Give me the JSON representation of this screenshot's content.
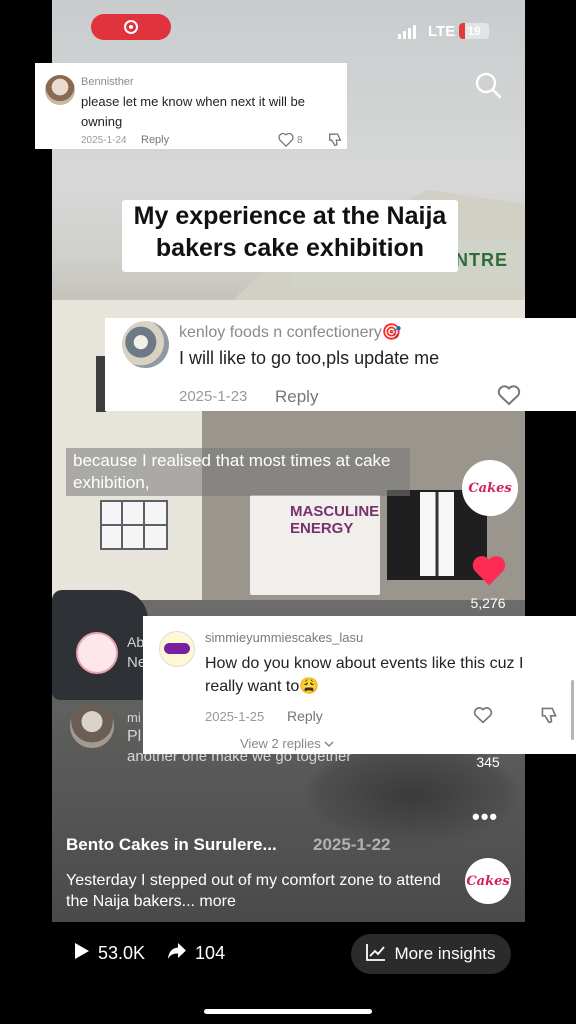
{
  "status_bar": {
    "network": "LTE",
    "battery": "19",
    "colors": {
      "record": "#e0333e",
      "battery_low": "#e23b3b"
    }
  },
  "top_comment": {
    "username": "Bennisther",
    "text": "please let me know when next it will be owning",
    "date": "2025-1-24",
    "reply": "Reply",
    "likes": "8"
  },
  "video_caption": "My experience at the Naija bakers cake exhibition",
  "scene_text": {
    "sign": "ENTRE",
    "banner": "MASCULINE ENERGY"
  },
  "comment_kenloy": {
    "username": "kenloy foods n confectionery🎯",
    "text": "I will like to go too,pls update me",
    "date": "2025-1-23",
    "reply": "Reply"
  },
  "subtitle": "because I realised that most times at cake exhibition,",
  "side_rail": {
    "avatar_logo": "Cakes",
    "likes": "5,276",
    "comments": "345",
    "like_color": "#fe2c55"
  },
  "ghost_comments": {
    "row1_user": "Ab",
    "row1_text": "Ne",
    "row2_user": "mi",
    "row2_text": "Pl",
    "row2_overflow": "another one make we go together"
  },
  "comment_simmie": {
    "username": "simmieyummiescakes_lasu",
    "text": "How do you know about events like this cuz I really want to😩",
    "date": "2025-1-25",
    "reply": "Reply",
    "view_replies": "View 2 replies"
  },
  "post": {
    "author": "Bento Cakes in Surulere...",
    "date": "2025-1-22",
    "description": "Yesterday I stepped out of my comfort zone to attend the Naija bakers... more",
    "avatar_logo": "Cakes"
  },
  "bottom_bar": {
    "plays": "53.0K",
    "shares": "104",
    "insights_label": "More insights"
  }
}
